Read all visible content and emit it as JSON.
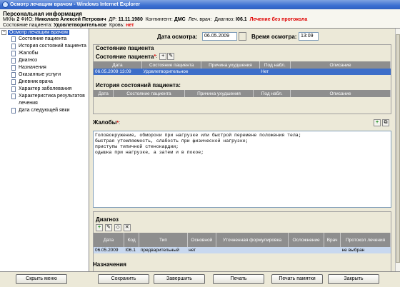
{
  "window": {
    "title": "Осмотр лечащим врачом - Windows Internet Explorer"
  },
  "header": {
    "title": "Персональная информация",
    "mk_label": "МК№",
    "mk_value": "2",
    "fio_label": "ФИО:",
    "fio_value": "Николаев Алексей Петрович",
    "dob_label": "ДР:",
    "dob_value": "11.11.1980",
    "contingent_label": "Контингент:",
    "contingent_value": "ДМС",
    "doctor_label": "Леч. врач:",
    "diag_label": "Диагноз:",
    "diag_value": "I06.1",
    "warning": "Лечение без протокола",
    "state_label": "Состояние пациента:",
    "state_value": "Удовлетворительное",
    "blood_label": "Кровь:",
    "blood_value": "нет"
  },
  "sidebar": {
    "root": "Осмотр лечащим врачом",
    "items": [
      "Состояние пациента",
      "История состояний пациента",
      "Жалобы",
      "Диагноз",
      "Назначения",
      "Оказанные услуги",
      "Дневник врача",
      "Характер заболевания",
      "Характеристика результатов лечения",
      "Дата следующей явки"
    ]
  },
  "exam": {
    "date_label": "Дата осмотра:",
    "date_value": "06.05.2009",
    "time_label": "Время осмотра:",
    "time_value": "13:09"
  },
  "patient_state": {
    "section_title": "Состояние пациента",
    "subtitle": "Состояние пациента",
    "columns": [
      "Дата",
      "Состояние пациента",
      "Причина ухудшения",
      "Под набл.",
      "Описание"
    ],
    "rows": [
      [
        "06.05.2009 13:09",
        "Удовлетворительное",
        "",
        "Нет",
        ""
      ]
    ],
    "history_title": "История состояний пациента:",
    "history_columns": [
      "Дата",
      "Состояние пациента",
      "Причина ухудшения",
      "Под набл.",
      "Описание"
    ]
  },
  "complaints": {
    "title": "Жалобы",
    "text": "Головокружение, обмороки при нагрузке или быстрой перемене положения тела;\nбыстрая утомляемость, слабость при физической нагрузке;\nприступы типичной стенокардии;\nодышка при нагрузке, а затем и в покое;"
  },
  "diagnosis": {
    "title": "Диагноз",
    "columns": [
      "Дата",
      "Код",
      "Тип",
      "Основной",
      "Уточненная формулировка",
      "Осложнение",
      "Врач",
      "Протокол лечения"
    ],
    "rows": [
      [
        "06.05.2009",
        "I06.1",
        "предварительный",
        "нет",
        "",
        "",
        "",
        "не выбран"
      ]
    ]
  },
  "assignments": {
    "title": "Назначения"
  },
  "footer": {
    "hide_menu": "Скрыть меню",
    "save": "Сохранить",
    "finish": "Завершить",
    "print": "Печать",
    "print_memo": "Печать памятки",
    "close": "Закрыть"
  }
}
